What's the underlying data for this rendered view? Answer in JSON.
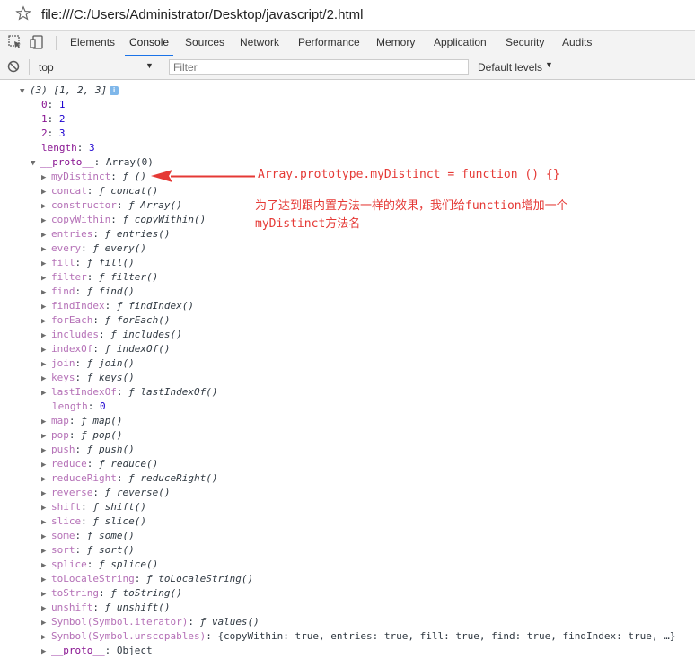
{
  "address_bar": {
    "url": "file:///C:/Users/Administrator/Desktop/javascript/2.html"
  },
  "devtools": {
    "tabs": [
      "Elements",
      "Console",
      "Sources",
      "Network",
      "Performance",
      "Memory",
      "Application",
      "Security",
      "Audits"
    ],
    "active_tab": "Console"
  },
  "console_toolbar": {
    "context": "top",
    "filter_placeholder": "Filter",
    "levels": "Default levels"
  },
  "console": {
    "summary": "(3) [1, 2, 3]",
    "entries": [
      {
        "key": "0",
        "value": "1"
      },
      {
        "key": "1",
        "value": "2"
      },
      {
        "key": "2",
        "value": "3"
      },
      {
        "key": "length",
        "value": "3"
      }
    ],
    "proto_label": "__proto__",
    "proto_value": "Array(0)",
    "proto_props": [
      {
        "key": "myDistinct",
        "value": "ƒ ()",
        "expandable": true,
        "highlight": true
      },
      {
        "key": "concat",
        "value": "ƒ concat()",
        "expandable": true
      },
      {
        "key": "constructor",
        "value": "ƒ Array()",
        "expandable": true
      },
      {
        "key": "copyWithin",
        "value": "ƒ copyWithin()",
        "expandable": true
      },
      {
        "key": "entries",
        "value": "ƒ entries()",
        "expandable": true
      },
      {
        "key": "every",
        "value": "ƒ every()",
        "expandable": true
      },
      {
        "key": "fill",
        "value": "ƒ fill()",
        "expandable": true
      },
      {
        "key": "filter",
        "value": "ƒ filter()",
        "expandable": true
      },
      {
        "key": "find",
        "value": "ƒ find()",
        "expandable": true
      },
      {
        "key": "findIndex",
        "value": "ƒ findIndex()",
        "expandable": true
      },
      {
        "key": "forEach",
        "value": "ƒ forEach()",
        "expandable": true
      },
      {
        "key": "includes",
        "value": "ƒ includes()",
        "expandable": true
      },
      {
        "key": "indexOf",
        "value": "ƒ indexOf()",
        "expandable": true
      },
      {
        "key": "join",
        "value": "ƒ join()",
        "expandable": true
      },
      {
        "key": "keys",
        "value": "ƒ keys()",
        "expandable": true
      },
      {
        "key": "lastIndexOf",
        "value": "ƒ lastIndexOf()",
        "expandable": true
      },
      {
        "key": "length",
        "value": "0",
        "expandable": false
      },
      {
        "key": "map",
        "value": "ƒ map()",
        "expandable": true
      },
      {
        "key": "pop",
        "value": "ƒ pop()",
        "expandable": true
      },
      {
        "key": "push",
        "value": "ƒ push()",
        "expandable": true
      },
      {
        "key": "reduce",
        "value": "ƒ reduce()",
        "expandable": true
      },
      {
        "key": "reduceRight",
        "value": "ƒ reduceRight()",
        "expandable": true
      },
      {
        "key": "reverse",
        "value": "ƒ reverse()",
        "expandable": true
      },
      {
        "key": "shift",
        "value": "ƒ shift()",
        "expandable": true
      },
      {
        "key": "slice",
        "value": "ƒ slice()",
        "expandable": true
      },
      {
        "key": "some",
        "value": "ƒ some()",
        "expandable": true
      },
      {
        "key": "sort",
        "value": "ƒ sort()",
        "expandable": true
      },
      {
        "key": "splice",
        "value": "ƒ splice()",
        "expandable": true
      },
      {
        "key": "toLocaleString",
        "value": "ƒ toLocaleString()",
        "expandable": true
      },
      {
        "key": "toString",
        "value": "ƒ toString()",
        "expandable": true
      },
      {
        "key": "unshift",
        "value": "ƒ unshift()",
        "expandable": true
      },
      {
        "key": "Symbol(Symbol.iterator)",
        "value": "ƒ values()",
        "expandable": true
      },
      {
        "key": "Symbol(Symbol.unscopables)",
        "value": "{copyWithin: true, entries: true, fill: true, find: true, findIndex: true, …}",
        "expandable": true
      },
      {
        "key": "__proto__",
        "value": "Object",
        "expandable": true,
        "dark": true
      }
    ]
  },
  "annotation": {
    "code": "Array.prototype.myDistinct = function () {}",
    "line1": "为了达到跟内置方法一样的效果，我们给function增加一个",
    "line2": "myDistinct方法名",
    "color": "#e53935"
  }
}
